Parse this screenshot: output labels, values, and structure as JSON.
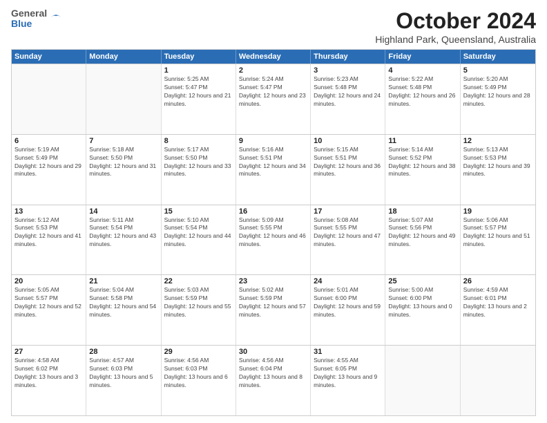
{
  "header": {
    "logo": {
      "line1": "General",
      "line2": "Blue"
    },
    "title": "October 2024",
    "subtitle": "Highland Park, Queensland, Australia"
  },
  "weekdays": [
    "Sunday",
    "Monday",
    "Tuesday",
    "Wednesday",
    "Thursday",
    "Friday",
    "Saturday"
  ],
  "weeks": [
    [
      {
        "day": "",
        "empty": true
      },
      {
        "day": "",
        "empty": true
      },
      {
        "day": "1",
        "sunrise": "Sunrise: 5:25 AM",
        "sunset": "Sunset: 5:47 PM",
        "daylight": "Daylight: 12 hours and 21 minutes."
      },
      {
        "day": "2",
        "sunrise": "Sunrise: 5:24 AM",
        "sunset": "Sunset: 5:47 PM",
        "daylight": "Daylight: 12 hours and 23 minutes."
      },
      {
        "day": "3",
        "sunrise": "Sunrise: 5:23 AM",
        "sunset": "Sunset: 5:48 PM",
        "daylight": "Daylight: 12 hours and 24 minutes."
      },
      {
        "day": "4",
        "sunrise": "Sunrise: 5:22 AM",
        "sunset": "Sunset: 5:48 PM",
        "daylight": "Daylight: 12 hours and 26 minutes."
      },
      {
        "day": "5",
        "sunrise": "Sunrise: 5:20 AM",
        "sunset": "Sunset: 5:49 PM",
        "daylight": "Daylight: 12 hours and 28 minutes."
      }
    ],
    [
      {
        "day": "6",
        "sunrise": "Sunrise: 5:19 AM",
        "sunset": "Sunset: 5:49 PM",
        "daylight": "Daylight: 12 hours and 29 minutes."
      },
      {
        "day": "7",
        "sunrise": "Sunrise: 5:18 AM",
        "sunset": "Sunset: 5:50 PM",
        "daylight": "Daylight: 12 hours and 31 minutes."
      },
      {
        "day": "8",
        "sunrise": "Sunrise: 5:17 AM",
        "sunset": "Sunset: 5:50 PM",
        "daylight": "Daylight: 12 hours and 33 minutes."
      },
      {
        "day": "9",
        "sunrise": "Sunrise: 5:16 AM",
        "sunset": "Sunset: 5:51 PM",
        "daylight": "Daylight: 12 hours and 34 minutes."
      },
      {
        "day": "10",
        "sunrise": "Sunrise: 5:15 AM",
        "sunset": "Sunset: 5:51 PM",
        "daylight": "Daylight: 12 hours and 36 minutes."
      },
      {
        "day": "11",
        "sunrise": "Sunrise: 5:14 AM",
        "sunset": "Sunset: 5:52 PM",
        "daylight": "Daylight: 12 hours and 38 minutes."
      },
      {
        "day": "12",
        "sunrise": "Sunrise: 5:13 AM",
        "sunset": "Sunset: 5:53 PM",
        "daylight": "Daylight: 12 hours and 39 minutes."
      }
    ],
    [
      {
        "day": "13",
        "sunrise": "Sunrise: 5:12 AM",
        "sunset": "Sunset: 5:53 PM",
        "daylight": "Daylight: 12 hours and 41 minutes."
      },
      {
        "day": "14",
        "sunrise": "Sunrise: 5:11 AM",
        "sunset": "Sunset: 5:54 PM",
        "daylight": "Daylight: 12 hours and 43 minutes."
      },
      {
        "day": "15",
        "sunrise": "Sunrise: 5:10 AM",
        "sunset": "Sunset: 5:54 PM",
        "daylight": "Daylight: 12 hours and 44 minutes."
      },
      {
        "day": "16",
        "sunrise": "Sunrise: 5:09 AM",
        "sunset": "Sunset: 5:55 PM",
        "daylight": "Daylight: 12 hours and 46 minutes."
      },
      {
        "day": "17",
        "sunrise": "Sunrise: 5:08 AM",
        "sunset": "Sunset: 5:55 PM",
        "daylight": "Daylight: 12 hours and 47 minutes."
      },
      {
        "day": "18",
        "sunrise": "Sunrise: 5:07 AM",
        "sunset": "Sunset: 5:56 PM",
        "daylight": "Daylight: 12 hours and 49 minutes."
      },
      {
        "day": "19",
        "sunrise": "Sunrise: 5:06 AM",
        "sunset": "Sunset: 5:57 PM",
        "daylight": "Daylight: 12 hours and 51 minutes."
      }
    ],
    [
      {
        "day": "20",
        "sunrise": "Sunrise: 5:05 AM",
        "sunset": "Sunset: 5:57 PM",
        "daylight": "Daylight: 12 hours and 52 minutes."
      },
      {
        "day": "21",
        "sunrise": "Sunrise: 5:04 AM",
        "sunset": "Sunset: 5:58 PM",
        "daylight": "Daylight: 12 hours and 54 minutes."
      },
      {
        "day": "22",
        "sunrise": "Sunrise: 5:03 AM",
        "sunset": "Sunset: 5:59 PM",
        "daylight": "Daylight: 12 hours and 55 minutes."
      },
      {
        "day": "23",
        "sunrise": "Sunrise: 5:02 AM",
        "sunset": "Sunset: 5:59 PM",
        "daylight": "Daylight: 12 hours and 57 minutes."
      },
      {
        "day": "24",
        "sunrise": "Sunrise: 5:01 AM",
        "sunset": "Sunset: 6:00 PM",
        "daylight": "Daylight: 12 hours and 59 minutes."
      },
      {
        "day": "25",
        "sunrise": "Sunrise: 5:00 AM",
        "sunset": "Sunset: 6:00 PM",
        "daylight": "Daylight: 13 hours and 0 minutes."
      },
      {
        "day": "26",
        "sunrise": "Sunrise: 4:59 AM",
        "sunset": "Sunset: 6:01 PM",
        "daylight": "Daylight: 13 hours and 2 minutes."
      }
    ],
    [
      {
        "day": "27",
        "sunrise": "Sunrise: 4:58 AM",
        "sunset": "Sunset: 6:02 PM",
        "daylight": "Daylight: 13 hours and 3 minutes."
      },
      {
        "day": "28",
        "sunrise": "Sunrise: 4:57 AM",
        "sunset": "Sunset: 6:03 PM",
        "daylight": "Daylight: 13 hours and 5 minutes."
      },
      {
        "day": "29",
        "sunrise": "Sunrise: 4:56 AM",
        "sunset": "Sunset: 6:03 PM",
        "daylight": "Daylight: 13 hours and 6 minutes."
      },
      {
        "day": "30",
        "sunrise": "Sunrise: 4:56 AM",
        "sunset": "Sunset: 6:04 PM",
        "daylight": "Daylight: 13 hours and 8 minutes."
      },
      {
        "day": "31",
        "sunrise": "Sunrise: 4:55 AM",
        "sunset": "Sunset: 6:05 PM",
        "daylight": "Daylight: 13 hours and 9 minutes."
      },
      {
        "day": "",
        "empty": true
      },
      {
        "day": "",
        "empty": true
      }
    ]
  ]
}
